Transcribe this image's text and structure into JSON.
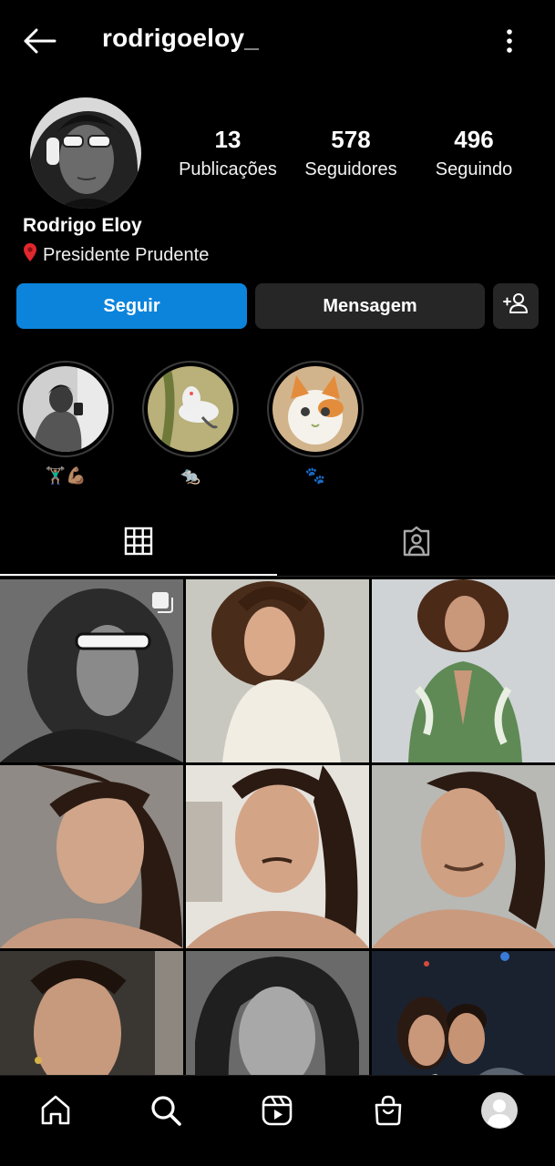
{
  "header": {
    "username": "rodrigoeloy_"
  },
  "profile": {
    "name": "Rodrigo Eloy",
    "bio_location": "Presidente Prudente",
    "bio_icon": "pin-emoji"
  },
  "stats": [
    {
      "value": "13",
      "label": "Publicações"
    },
    {
      "value": "578",
      "label": "Seguidores"
    },
    {
      "value": "496",
      "label": "Seguindo"
    }
  ],
  "actions": {
    "follow_label": "Seguir",
    "message_label": "Mensagem",
    "add_icon": "add-person-icon"
  },
  "highlights": [
    {
      "label": "🏋🏽‍♂️💪🏽",
      "icon": "gym-highlight"
    },
    {
      "label": "🐀",
      "icon": "rat-highlight"
    },
    {
      "label": "🐾",
      "icon": "cat-highlight"
    }
  ],
  "tabs": [
    {
      "name": "grid",
      "icon": "grid-icon",
      "active": true
    },
    {
      "name": "tagged",
      "icon": "tagged-person-icon",
      "active": false
    }
  ],
  "nav": [
    {
      "name": "home",
      "icon": "home-icon"
    },
    {
      "name": "search",
      "icon": "search-icon"
    },
    {
      "name": "reels",
      "icon": "reels-icon"
    },
    {
      "name": "shop",
      "icon": "shopping-bag-icon"
    },
    {
      "name": "profile",
      "icon": "profile-avatar-icon"
    }
  ],
  "colors": {
    "background": "#000000",
    "accent": "#0c84dc",
    "button_dark": "#262626"
  }
}
